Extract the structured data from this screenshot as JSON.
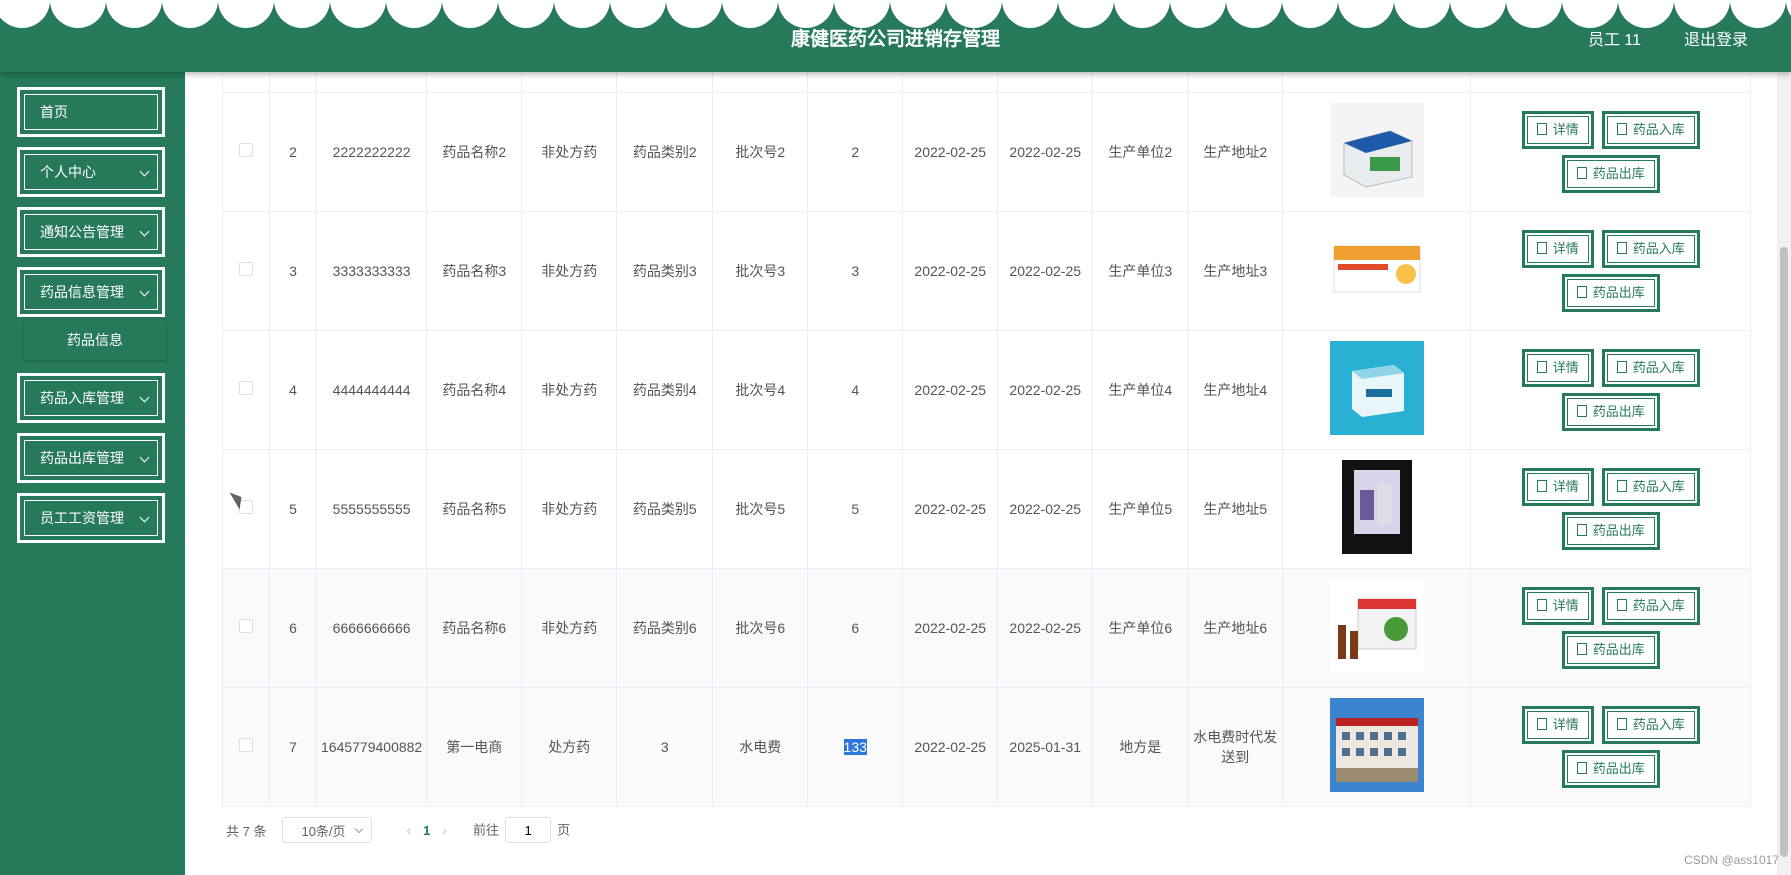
{
  "header": {
    "title": "康健医药公司进销存管理",
    "user": "员工 11",
    "logout": "退出登录"
  },
  "sidebar": {
    "items": [
      {
        "label": "首页"
      },
      {
        "label": "个人中心"
      },
      {
        "label": "通知公告管理"
      },
      {
        "label": "药品信息管理"
      },
      {
        "label": "药品入库管理"
      },
      {
        "label": "药品出库管理"
      },
      {
        "label": "员工工资管理"
      }
    ],
    "sub_item": "药品信息"
  },
  "table": {
    "rows": [
      {
        "no": "2",
        "code": "2222222222",
        "name": "药品名称2",
        "otc": "非处方药",
        "category": "药品类别2",
        "batch": "批次号2",
        "qty": "2",
        "date1": "2022-02-25",
        "date2": "2022-02-25",
        "unit": "生产单位2",
        "addr": "生产地址2"
      },
      {
        "no": "3",
        "code": "3333333333",
        "name": "药品名称3",
        "otc": "非处方药",
        "category": "药品类别3",
        "batch": "批次号3",
        "qty": "3",
        "date1": "2022-02-25",
        "date2": "2022-02-25",
        "unit": "生产单位3",
        "addr": "生产地址3"
      },
      {
        "no": "4",
        "code": "4444444444",
        "name": "药品名称4",
        "otc": "非处方药",
        "category": "药品类别4",
        "batch": "批次号4",
        "qty": "4",
        "date1": "2022-02-25",
        "date2": "2022-02-25",
        "unit": "生产单位4",
        "addr": "生产地址4"
      },
      {
        "no": "5",
        "code": "5555555555",
        "name": "药品名称5",
        "otc": "非处方药",
        "category": "药品类别5",
        "batch": "批次号5",
        "qty": "5",
        "date1": "2022-02-25",
        "date2": "2022-02-25",
        "unit": "生产单位5",
        "addr": "生产地址5"
      },
      {
        "no": "6",
        "code": "6666666666",
        "name": "药品名称6",
        "otc": "非处方药",
        "category": "药品类别6",
        "batch": "批次号6",
        "qty": "6",
        "date1": "2022-02-25",
        "date2": "2022-02-25",
        "unit": "生产单位6",
        "addr": "生产地址6"
      },
      {
        "no": "7",
        "code": "1645779400882",
        "name": "第一电商",
        "otc": "处方药",
        "category": "3",
        "batch": "水电费",
        "qty": "133",
        "date1": "2022-02-25",
        "date2": "2025-01-31",
        "unit": "地方是",
        "addr": "水电费时代发送到"
      }
    ],
    "actions": {
      "detail": "详情",
      "stock_in": "药品入库",
      "stock_out": "药品出库"
    }
  },
  "pagination": {
    "total": "共 7 条",
    "page_size": "10条/页",
    "current": "1",
    "goto_label": "前往",
    "goto_value": "1",
    "page_suffix": "页"
  },
  "watermark": "CSDN @ass1017",
  "colors": {
    "primary": "#267a5a",
    "highlight": "#2b76d9"
  }
}
